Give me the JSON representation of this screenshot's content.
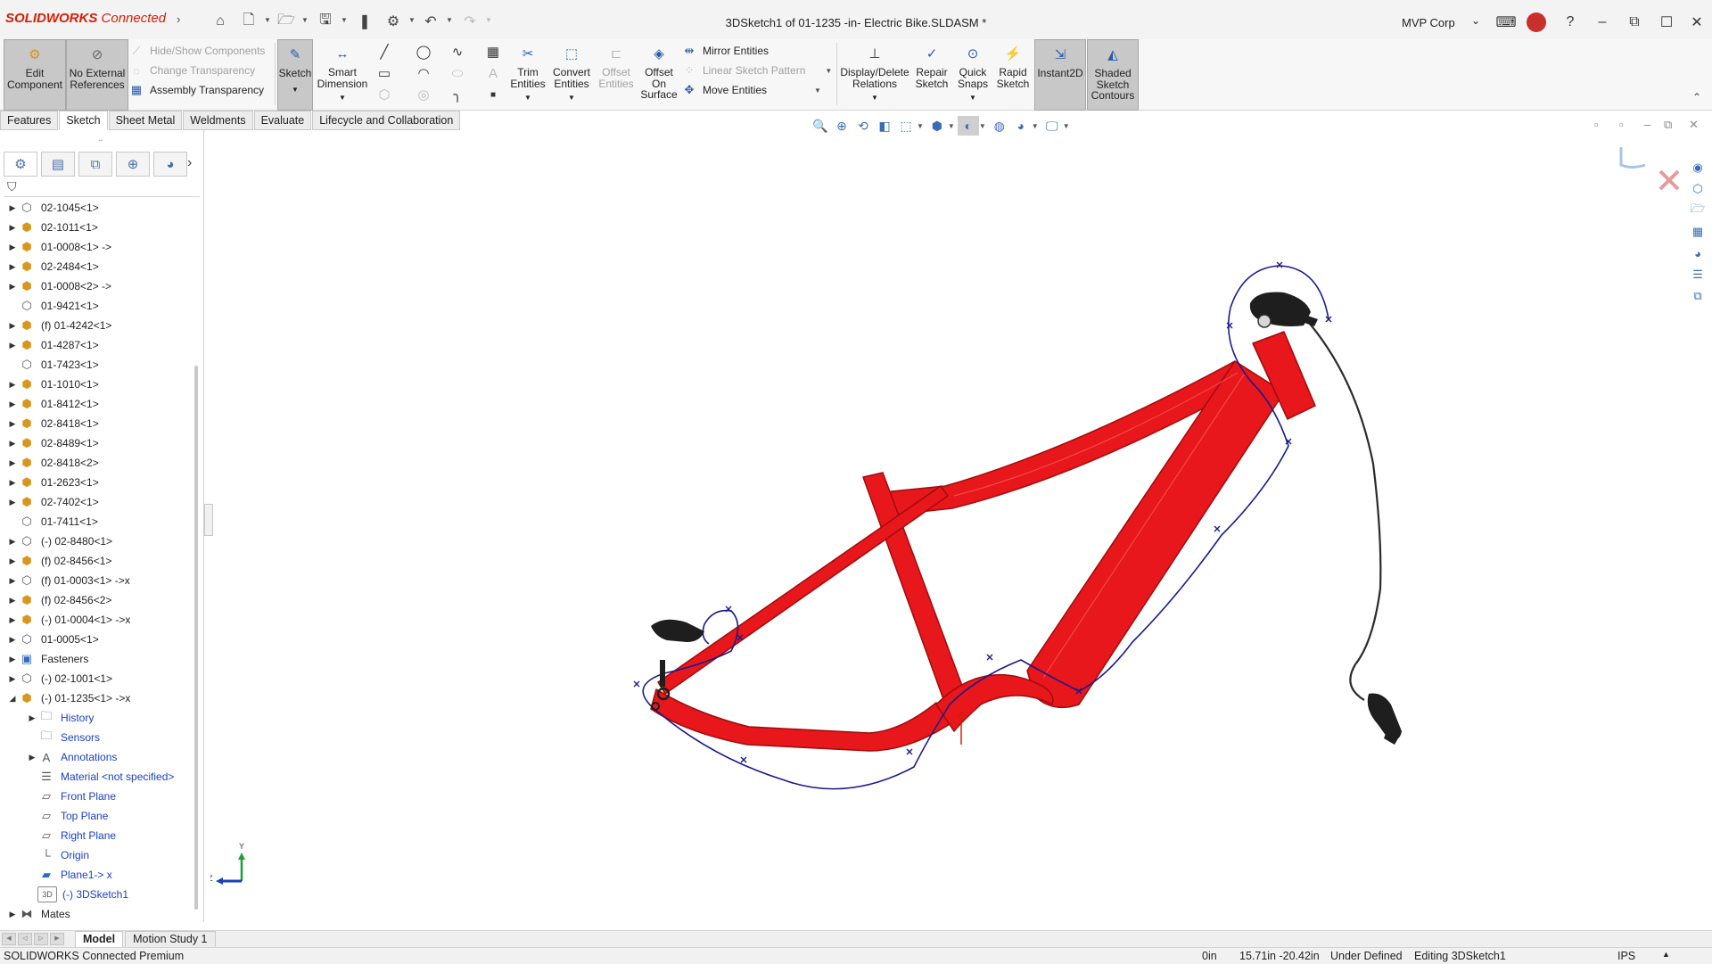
{
  "app": {
    "logo_brand": "SOLIDWORKS",
    "logo_suffix": "Connected",
    "document_title": "3DSketch1 of 01-1235 -in- Electric Bike.SLDASM *",
    "organization": "MVP Corp"
  },
  "ribbon": {
    "edit_component": "Edit Component",
    "no_external_references": "No External References",
    "hide_show_components": "Hide/Show Components",
    "change_transparency": "Change Transparency",
    "assembly_transparency": "Assembly Transparency",
    "sketch": "Sketch",
    "smart_dimension": "Smart Dimension",
    "trim_entities": "Trim Entities",
    "convert_entities": "Convert Entities",
    "offset_entities": "Offset Entities",
    "offset_on_surface": "Offset On Surface",
    "mirror_entities": "Mirror Entities",
    "linear_sketch_pattern": "Linear Sketch Pattern",
    "move_entities": "Move Entities",
    "display_delete_relations": "Display/Delete Relations",
    "repair_sketch": "Repair Sketch",
    "quick_snaps": "Quick Snaps",
    "rapid_sketch": "Rapid Sketch",
    "instant2d": "Instant2D",
    "shaded_sketch_contours": "Shaded Sketch Contours"
  },
  "tabs": [
    "Features",
    "Sketch",
    "Sheet Metal",
    "Weldments",
    "Evaluate",
    "Lifecycle and Collaboration"
  ],
  "tree": [
    {
      "label": "02-1045<1>",
      "icon": "part"
    },
    {
      "label": "02-1011<1>",
      "icon": "asm"
    },
    {
      "label": "01-0008<1> ->",
      "icon": "asm"
    },
    {
      "label": "02-2484<1>",
      "icon": "asm"
    },
    {
      "label": "01-0008<2> ->",
      "icon": "asm"
    },
    {
      "label": "01-9421<1>",
      "icon": "part"
    },
    {
      "label": "(f) 01-4242<1>",
      "icon": "asm"
    },
    {
      "label": "01-4287<1>",
      "icon": "asm"
    },
    {
      "label": "01-7423<1>",
      "icon": "part"
    },
    {
      "label": "01-1010<1>",
      "icon": "asm"
    },
    {
      "label": "01-8412<1>",
      "icon": "asm"
    },
    {
      "label": "02-8418<1>",
      "icon": "asm"
    },
    {
      "label": "02-8489<1>",
      "icon": "asm"
    },
    {
      "label": "02-8418<2>",
      "icon": "asm"
    },
    {
      "label": "01-2623<1>",
      "icon": "asm"
    },
    {
      "label": "02-7402<1>",
      "icon": "asm"
    },
    {
      "label": "01-7411<1>",
      "icon": "part"
    },
    {
      "label": "(-) 02-8480<1>",
      "icon": "part"
    },
    {
      "label": "(f) 02-8456<1>",
      "icon": "asm"
    },
    {
      "label": "(f) 01-0003<1> ->x",
      "icon": "part"
    },
    {
      "label": "(f) 02-8456<2>",
      "icon": "asm"
    },
    {
      "label": "(-) 01-0004<1> ->x",
      "icon": "asm"
    },
    {
      "label": "01-0005<1>",
      "icon": "part"
    },
    {
      "label": "Fasteners",
      "icon": "folder"
    },
    {
      "label": "(-) 02-1001<1>",
      "icon": "part"
    },
    {
      "label": "(-) 01-1235<1> ->x",
      "icon": "asm"
    },
    {
      "label": "History",
      "icon": "history"
    },
    {
      "label": "Sensors",
      "icon": "sensor"
    },
    {
      "label": "Annotations",
      "icon": "annot"
    },
    {
      "label": "Material <not specified>",
      "icon": "material"
    },
    {
      "label": "Front Plane",
      "icon": "plane"
    },
    {
      "label": "Top Plane",
      "icon": "plane"
    },
    {
      "label": "Right Plane",
      "icon": "plane"
    },
    {
      "label": "Origin",
      "icon": "origin"
    },
    {
      "label": "Plane1-> x",
      "icon": "plane"
    },
    {
      "label": "(-) 3DSketch1",
      "icon": "sketch3d"
    },
    {
      "label": "Mates",
      "icon": "mates"
    }
  ],
  "bottom_tabs": [
    "Model",
    "Motion Study 1"
  ],
  "status": {
    "product": "SOLIDWORKS Connected Premium",
    "z": "0in",
    "coords": "15.71in -20.42in",
    "state": "Under Defined",
    "mode": "Editing 3DSketch1",
    "units": "IPS"
  },
  "triad": {
    "y": "Y",
    "z": "Z"
  },
  "colors": {
    "frame": "#e8171b",
    "sketch": "#1a1a8c",
    "cable": "#2b2b2b",
    "accent": "#d81e05"
  }
}
